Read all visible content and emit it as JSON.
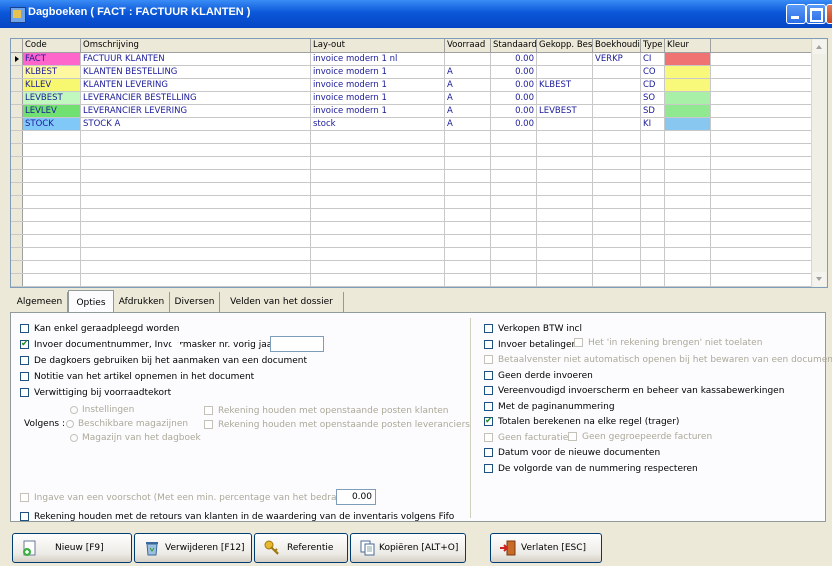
{
  "window": {
    "title": "Dagboeken ( FACT : FACTUUR KLANTEN )"
  },
  "grid": {
    "headers": [
      "Code",
      "Omschrijving",
      "Lay-out",
      "Voorraad",
      "Standaard",
      "Gekopp. Bes",
      "Boekhoudi",
      "Type",
      "Kleur"
    ],
    "rows": [
      {
        "code": "FACT",
        "omschrijving": "FACTUUR KLANTEN",
        "layout": "invoice modern 1 nl",
        "voorraad": "",
        "standaard": "0.00",
        "gekopp": "",
        "boekhoud": "VERKP",
        "type": "CI",
        "kleur": "#f07373",
        "code_bg": "#ff66cc",
        "selected": true
      },
      {
        "code": "KLBEST",
        "omschrijving": "KLANTEN BESTELLING",
        "layout": "invoice modern 1",
        "voorraad": "A",
        "standaard": "0.00",
        "gekopp": "",
        "boekhoud": "",
        "type": "CO",
        "kleur": "#f8f87a",
        "code_bg": "#fff8a0"
      },
      {
        "code": "KLLEV",
        "omschrijving": "KLANTEN LEVERING",
        "layout": "invoice modern 1",
        "voorraad": "A",
        "standaard": "0.00",
        "gekopp": "KLBEST",
        "boekhoud": "",
        "type": "CD",
        "kleur": "#f8f87a",
        "code_bg": "#f8f870"
      },
      {
        "code": "LEVBEST",
        "omschrijving": "LEVERANCIER BESTELLING",
        "layout": "invoice modern 1",
        "voorraad": "A",
        "standaard": "0.00",
        "gekopp": "",
        "boekhoud": "",
        "type": "SO",
        "kleur": "#a8f0a8",
        "code_bg": "#c0f8c0"
      },
      {
        "code": "LEVLEV",
        "omschrijving": "LEVERANCIER LEVERING",
        "layout": "invoice modern 1",
        "voorraad": "A",
        "standaard": "0.00",
        "gekopp": "LEVBEST",
        "boekhoud": "",
        "type": "SD",
        "kleur": "#90e890",
        "code_bg": "#70e070"
      },
      {
        "code": "STOCK",
        "omschrijving": "STOCK A",
        "layout": "stock",
        "voorraad": "A",
        "standaard": "0.00",
        "gekopp": "",
        "boekhoud": "",
        "type": "KI",
        "kleur": "#88c8f0",
        "code_bg": "#80c8f8"
      }
    ]
  },
  "tabs": [
    "Algemeen",
    "Opties",
    "Afdrukken",
    "Diversen",
    "Velden van het dossier"
  ],
  "left_options": [
    {
      "label": "Kan enkel geraadpleegd worden",
      "checked": false,
      "disabled": false
    },
    {
      "label": "Invoer documentnummer, Invoermasker nr. vorig jaar",
      "checked": true,
      "disabled": false
    },
    {
      "label": "De dagkoers gebruiken bij het aanmaken van een document",
      "checked": false,
      "disabled": false
    },
    {
      "label": "Notitie van het artikel opnemen in het document",
      "checked": false,
      "disabled": false
    },
    {
      "label": "Verwittiging bij voorraadtekort",
      "checked": false,
      "disabled": false
    }
  ],
  "volgens": {
    "label": "Volgens :",
    "radios": [
      "Instellingen",
      "Beschikbare magazijnen",
      "Magazijn van het dagboek"
    ],
    "checks": [
      "Rekening houden met openstaande posten klanten",
      "Rekening houden met openstaande posten leveranciers"
    ]
  },
  "voorschot": {
    "label": "Ingave van een voorschot (Met een min. percentage van het bedrag)",
    "value": "0.00"
  },
  "retours": {
    "label": "Rekening houden met de retours van klanten in de waardering van de inventaris volgens Fifo"
  },
  "right_options": [
    {
      "label": "Verkopen BTW incl",
      "checked": false,
      "disabled": false
    },
    {
      "label": "Invoer betalingen",
      "checked": false,
      "disabled": false
    },
    {
      "label": "Betaalvenster niet automatisch openen bij het bewaren van een document",
      "checked": false,
      "disabled": true
    },
    {
      "label": "Geen derde invoeren",
      "checked": false,
      "disabled": false
    },
    {
      "label": "Vereenvoudigd invoerscherm en beheer van kassabewerkingen",
      "checked": false,
      "disabled": false
    },
    {
      "label": "Met de paginanummering",
      "checked": false,
      "disabled": false
    },
    {
      "label": "Totalen berekenen na elke regel (trager)",
      "checked": true,
      "disabled": false
    },
    {
      "label": "Geen facturatie",
      "checked": false,
      "disabled": true
    },
    {
      "label": "Datum voor de nieuwe documenten",
      "checked": false,
      "disabled": false
    },
    {
      "label": "De volgorde van de nummering respecteren",
      "checked": false,
      "disabled": false
    }
  ],
  "right_inline": {
    "betalingen_sub": "Het 'in rekening brengen' niet toelaten",
    "facturatie_sub": "Geen gegroepeerde facturen"
  },
  "buttons": {
    "nieuw": "Nieuw [F9]",
    "verwijderen": "Verwijderen [F12]",
    "referentie": "Referentie",
    "kopieren": "Kopiëren [ALT+O]",
    "verlaten": "Verlaten [ESC]"
  }
}
